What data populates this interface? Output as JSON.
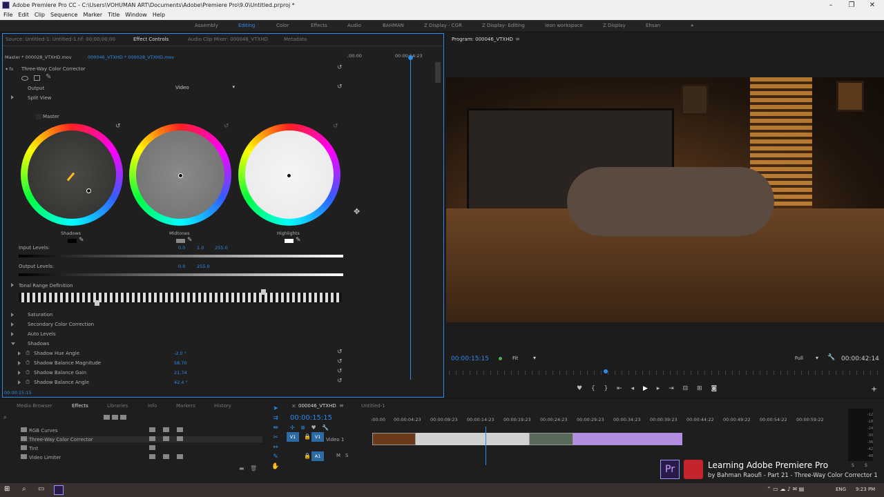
{
  "window": {
    "title": "Adobe Premiere Pro CC - C:\\Users\\VOHUMAN ART\\Documents\\Adobe\\Premiere Pro\\9.0\\Untitled.prproj *"
  },
  "menu": [
    "File",
    "Edit",
    "Clip",
    "Sequence",
    "Marker",
    "Title",
    "Window",
    "Help"
  ],
  "workspaces": [
    "Assembly",
    "Editing",
    "Color",
    "Effects",
    "Audio",
    "BAHMAN",
    "Z Display - CGR",
    "Z Display- Editing",
    "Ieon workspace",
    "Z Display",
    "Ehsan"
  ],
  "left_tabs": {
    "source": "Source: Untitled-1: Untitled-1.tif: 00;00;00;00",
    "effect_controls": "Effect Controls",
    "audio_mixer": "Audio Clip Mixer: 000046_VTXHD",
    "metadata": "Metadata"
  },
  "ec": {
    "master": "Master * 000028_VTXHD.mov",
    "clip": "000046_VTXHD * 000028_VTXHD.mov",
    "tc_left": ";00:00",
    "tc_right": "00:00:14:23",
    "effect": "Three-Way Color Corrector",
    "output_label": "Output",
    "output_value": "Video",
    "split_view": "Split View",
    "master_label": "Master",
    "wheels": [
      "Shadows",
      "Midtones",
      "Highlights"
    ],
    "input_levels": "Input Levels:",
    "in0": "0.0",
    "in1": "1.0",
    "in2": "255.0",
    "output_levels": "Output Levels:",
    "out0": "0.0",
    "out1": "255.0",
    "tonal": "Tonal Range Definition",
    "saturation": "Saturation",
    "secondary": "Secondary Color Correction",
    "auto": "Auto Levels",
    "shadows": "Shadows",
    "params": [
      {
        "name": "Shadow Hue Angle",
        "value": "-2.0 °"
      },
      {
        "name": "Shadow Balance Magnitude",
        "value": "58.70"
      },
      {
        "name": "Shadow Balance Gain",
        "value": "21.74"
      },
      {
        "name": "Shadow Balance Angle",
        "value": "42.4 °"
      }
    ],
    "bottom_tc": "00:00:15:15"
  },
  "program": {
    "title": "Program: 000046_VTXHD",
    "tc": "00:00:15:15",
    "fit": "Fit",
    "full": "Full",
    "duration": "00:00:42:14"
  },
  "project_tabs": [
    "Media Browser",
    "Effects",
    "Libraries",
    "Info",
    "Markers",
    "History"
  ],
  "effects_list": [
    "RGB Curves",
    "Three-Way Color Corrector",
    "Tint",
    "Video Limiter"
  ],
  "timeline": {
    "tab1": "000046_VTXHD",
    "tab2": "Untitled-1",
    "tc": "00:00:15:15",
    "ruler": [
      ":00:00",
      "00:00:04:23",
      "00:00:09:23",
      "00:00:14:23",
      "00:00:19:23",
      "00:00:24:23",
      "00:00:29:23",
      "00:00:34:23",
      "00:00:39:23",
      "00:00:44:22",
      "00:00:49:22",
      "00:00:54:22",
      "00:00:59:22"
    ],
    "v1": "V1",
    "track_v1": "Video 1",
    "a1": "A1",
    "m": "M",
    "s": "S"
  },
  "meter": [
    "-12",
    "-18",
    "-24",
    "-30",
    "-36",
    "-42",
    "-48"
  ],
  "meter_ss": [
    "S",
    "S"
  ],
  "overlay": {
    "title": "Learning Adobe Premiere Pro",
    "subtitle": "by Bahman Raoufi - Part 21 - Three-Way Color Corrector 1"
  },
  "taskbar": {
    "lang": "ENG",
    "time": "9:23 PM"
  }
}
